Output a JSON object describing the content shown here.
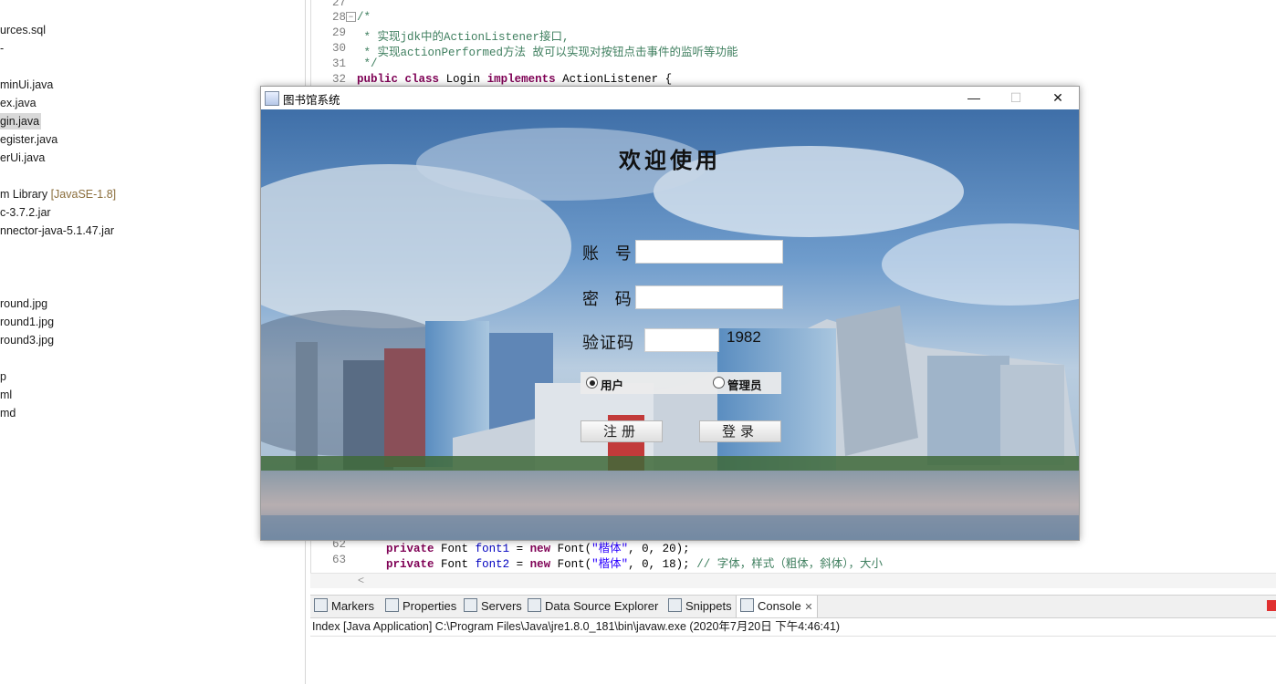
{
  "explorer": {
    "items": [
      "urces.sql",
      "-",
      "minUi.java",
      "ex.java",
      "gin.java",
      "egister.java",
      "erUi.java",
      "m Library",
      "[JavaSE-1.8]",
      "c-3.7.2.jar",
      "nnector-java-5.1.47.jar",
      "round.jpg",
      "round1.jpg",
      "round3.jpg",
      "p",
      "ml",
      "md"
    ]
  },
  "editor": {
    "lines": [
      {
        "no": "27",
        "text": ""
      },
      {
        "no": "28",
        "text": "/*"
      },
      {
        "no": "29",
        "text": " * 实现jdk中的ActionListener接口,"
      },
      {
        "no": "30",
        "text": " * 实现actionPerformed方法 故可以实现对按钮点击事件的监听等功能"
      },
      {
        "no": "31",
        "text": " */"
      },
      {
        "no": "32",
        "kw1": "public",
        "kw2": "class",
        "name": "Login",
        "kw3": "implements",
        "iface": "ActionListener {"
      },
      {
        "no": "62",
        "kw": "private",
        "type": "Font",
        "field": "font1",
        "op": " = ",
        "kwnew": "new",
        "ctor": "Font(",
        "str": "\"楷体\"",
        "args": ", 0, 20);",
        "comment": ""
      },
      {
        "no": "63",
        "kw": "private",
        "type": "Font",
        "field": "font2",
        "op": " = ",
        "kwnew": "new",
        "ctor": "Font(",
        "str": "\"楷体\"",
        "args": ", 0, 18);",
        "comment": "// 字体，样式（粗体，斜体），大小"
      }
    ],
    "scroll_marker": "<"
  },
  "views": {
    "tabs": [
      "Markers",
      "Properties",
      "Servers",
      "Data Source Explorer",
      "Snippets",
      "Console"
    ],
    "active": "Console",
    "close": "✕",
    "console_status": "Index [Java Application] C:\\Program Files\\Java\\jre1.8.0_181\\bin\\javaw.exe (2020年7月20日 下午4:46:41)"
  },
  "app": {
    "title": "图书馆系统",
    "controls": {
      "minimize": "—",
      "maximize": "☐",
      "close": "✕"
    },
    "heading": "欢迎使用",
    "labels": {
      "account": "账 号",
      "password": "密 码",
      "captcha": "验证码"
    },
    "fields": {
      "account": "",
      "password": "",
      "captcha": ""
    },
    "captcha_code": "1982",
    "roles": {
      "user": "用户",
      "admin": "管理员",
      "selected": "用户"
    },
    "buttons": {
      "register": "注册",
      "login": "登录"
    }
  },
  "colors": {
    "keyword": "#7f0055",
    "field": "#0000c0",
    "string": "#2a00ff",
    "comment": "#3f7f5f"
  },
  "icons": {
    "title_app": "java-app-icon",
    "fold": "fold-minus-icon",
    "markers": "markers-icon",
    "properties": "properties-icon",
    "servers": "servers-icon",
    "dse": "data-source-explorer-icon",
    "snippets": "snippets-icon",
    "console": "console-icon"
  }
}
